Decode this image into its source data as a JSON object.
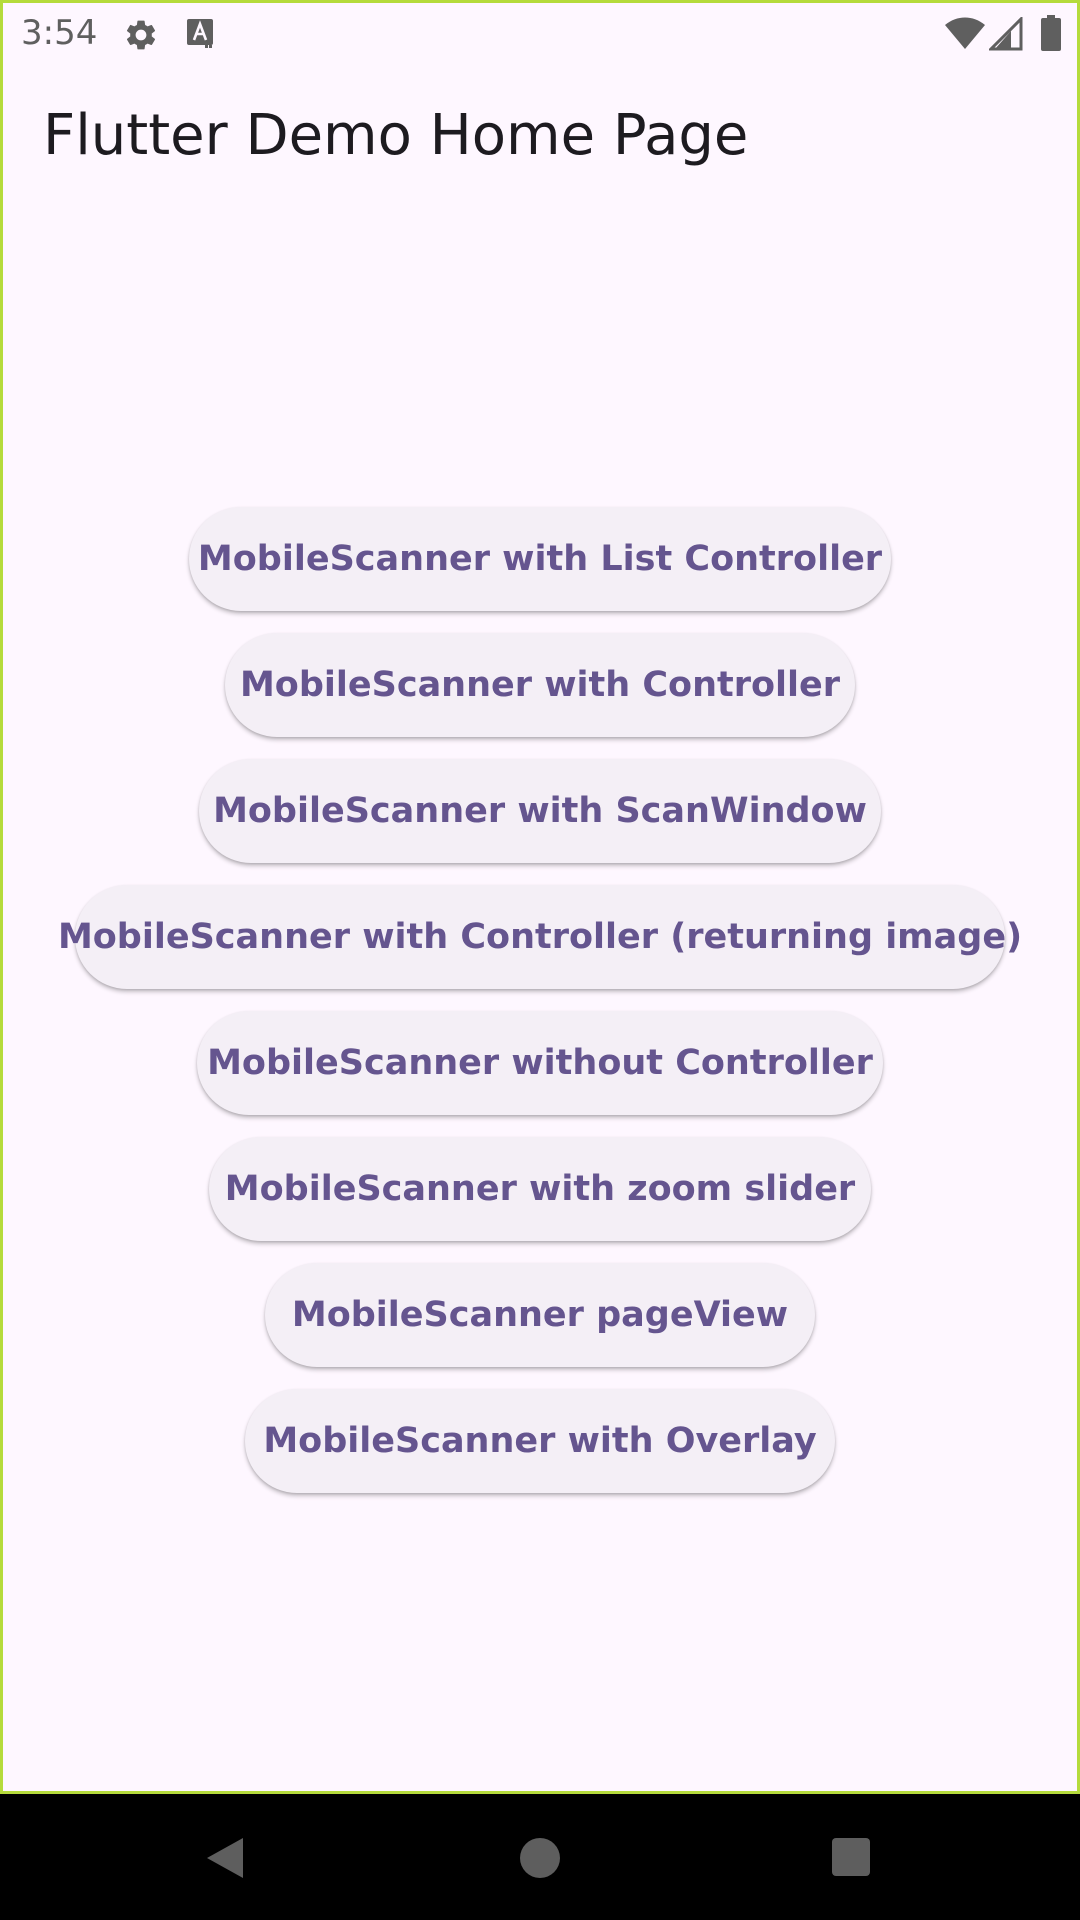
{
  "status_bar": {
    "time": "3:54",
    "icons": [
      "gear-icon",
      "a-icon",
      "wifi-icon",
      "signal-icon",
      "battery-icon"
    ]
  },
  "app_bar": {
    "title": "Flutter Demo Home Page"
  },
  "buttons": [
    {
      "label": "MobileScanner with List Controller"
    },
    {
      "label": "MobileScanner with Controller"
    },
    {
      "label": "MobileScanner with ScanWindow"
    },
    {
      "label": "MobileScanner with Controller (returning image)"
    },
    {
      "label": "MobileScanner without Controller"
    },
    {
      "label": "MobileScanner with zoom slider"
    },
    {
      "label": "MobileScanner pageView"
    },
    {
      "label": "MobileScanner with Overlay"
    }
  ],
  "nav_bar": {
    "icons": [
      "back-icon",
      "home-icon",
      "recents-icon"
    ]
  },
  "colors": {
    "background": "#fef7ff",
    "button_background": "#f4eff6",
    "button_text": "#65558f",
    "title_text": "#1d1b20",
    "frame_border": "#b5db3c"
  }
}
